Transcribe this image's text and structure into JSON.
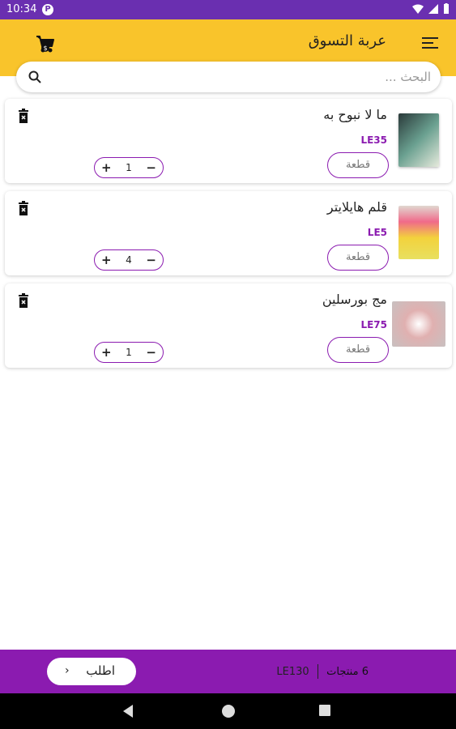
{
  "status_bar": {
    "time": "10:34",
    "p_label": "P"
  },
  "header": {
    "title": "عربة التسوق",
    "menu_icon": "menu-icon",
    "cart_icon": "cart-icon"
  },
  "search": {
    "placeholder": "البحث ..."
  },
  "cart_items": [
    {
      "name": "ما لا نبوح به",
      "price": "LE35",
      "unit_label": "قطعة",
      "quantity": "1",
      "minus": "−",
      "plus": "+",
      "thumb_color": "#5e8a7a"
    },
    {
      "name": "قلم هايلايتر",
      "price": "LE5",
      "unit_label": "قطعة",
      "quantity": "4",
      "minus": "−",
      "plus": "+",
      "thumb_color": "#f3d23c"
    },
    {
      "name": "مج  بورسلين",
      "price": "LE75",
      "unit_label": "قطعة",
      "quantity": "1",
      "minus": "−",
      "plus": "+",
      "thumb_color": "#d9c7c7"
    }
  ],
  "bottom_bar": {
    "count_text": "6 منتجات",
    "total": "LE130",
    "order_label": "اطلب",
    "chevron": "›"
  },
  "colors": {
    "header": "#f9c42b",
    "accent": "#8b1bb0",
    "status": "#6a2fb0"
  }
}
